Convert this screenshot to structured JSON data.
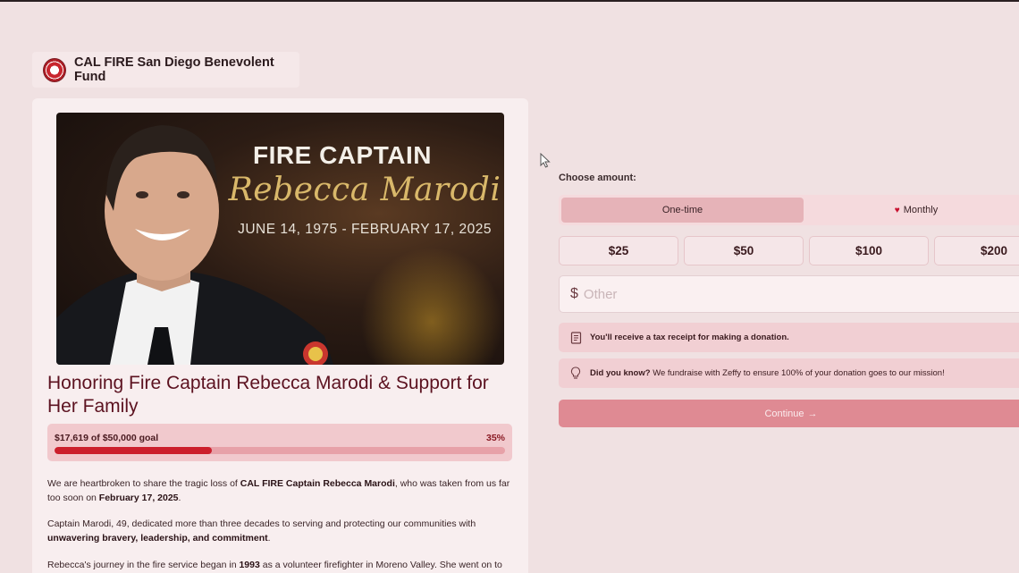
{
  "org": {
    "name": "CAL FIRE San Diego Benevolent Fund"
  },
  "hero": {
    "title": "FIRE CAPTAIN",
    "name": "Rebecca Marodi",
    "dates": "JUNE 14, 1975 - FEBRUARY 17, 2025"
  },
  "campaign": {
    "title": "Honoring Fire Captain Rebecca Marodi & Support for Her Family",
    "progress_label": "$17,619 of $50,000 goal",
    "progress_percent_label": "35%",
    "progress_fraction": 0.35
  },
  "story": {
    "p1": {
      "a": "We are heartbroken to share the tragic loss of ",
      "b": "CAL FIRE Captain Rebecca Marodi",
      "c": ", who was taken from us far too soon on ",
      "d": "February 17, 2025",
      "e": "."
    },
    "p2": {
      "a": "Captain Marodi, 49, dedicated more than three decades to serving and protecting our communities with ",
      "b": "unwavering bravery, leadership, and commitment",
      "c": "."
    },
    "p3": {
      "a": "Rebecca's journey in the fire service began in ",
      "b": "1993",
      "c": " as a volunteer firefighter in Moreno Valley. She went on to"
    }
  },
  "donation": {
    "choose_label": "Choose amount:",
    "frequency": {
      "one_time": "One-time",
      "monthly": "Monthly",
      "selected": "One-time"
    },
    "amounts": [
      "$25",
      "$50",
      "$100",
      "$200"
    ],
    "other": {
      "currency": "$",
      "placeholder": "Other"
    },
    "tax_note": "You'll receive a tax receipt for making a donation.",
    "did_you_know": {
      "lead": "Did you know?",
      "text": " We fundraise with Zeffy to ensure 100% of your donation goes to our mission!"
    },
    "continue_label": "Continue",
    "continue_arrow": "→"
  },
  "colors": {
    "accent": "#cc1f2c",
    "title": "#5c1220",
    "button": "#df8a93"
  }
}
